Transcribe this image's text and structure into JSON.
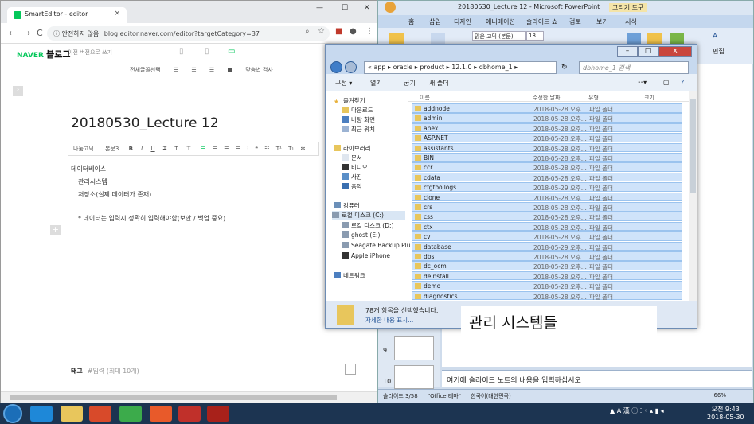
{
  "chrome": {
    "tab_title": "SmartEditor - editor",
    "close_icon": "×",
    "minimize": "—",
    "maximize": "☐",
    "close": "✕",
    "back": "←",
    "forward": "→",
    "reload": "C",
    "security": "ⓘ 안전하지 않음",
    "url": "blog.editor.naver.com/editor?targetCategory=37"
  },
  "editor": {
    "brand": "NAVER",
    "brand_sub": "블로그",
    "prev_version": "이전 버전으로 쓰기",
    "select_all": "전체글꼴선택",
    "spellcheck": "맞춤법 검사",
    "title": "20180530_Lecture 12",
    "font_name": "나눔고딕",
    "font_body": "본문3",
    "lines": [
      "데이터베이스",
      "관리시스템",
      "저장소(실제 데이터가 존재)",
      "* 데이터는 입력시 정확히 입력해야함(보안 / 백업 중요)"
    ],
    "tag_label": "태그",
    "tag_placeholder": "#입력 (최대 10개)"
  },
  "ppt": {
    "title": "20180530_Lecture 12 - Microsoft PowerPoint",
    "drawing_tools": "그리기 도구",
    "tabs": [
      "홈",
      "삽입",
      "디자인",
      "애니메이션",
      "슬라이드 쇼",
      "검토",
      "보기",
      "서식"
    ],
    "font": "맑은 고딕 (본문)",
    "size": "18",
    "edit_label": "편집",
    "slide_nums": [
      "9",
      "10"
    ],
    "notes": "여기에 슬라이드 노트의 내용을 입력하십시오",
    "status_slide": "슬라이드 3/58",
    "status_theme": "\"Office 테마\"",
    "status_lang": "한국어(대한민국)",
    "zoom": "66%"
  },
  "explorer": {
    "breadcrumb": "« app ▸ oracle ▸ product ▸ 12.1.0 ▸ dbhome_1 ▸",
    "search_placeholder": "dbhome_1 검색",
    "toolbar": [
      "구성 ▾",
      "열기",
      "굽기",
      "새 폴더"
    ],
    "nav_favorites": "즐겨찾기",
    "nav_items": [
      "다운로드",
      "바탕 화면",
      "최근 위치"
    ],
    "nav_library": "라이브러리",
    "library_items": [
      "문서",
      "비디오",
      "사진",
      "음악"
    ],
    "nav_computer": "컴퓨터",
    "drives": [
      "로컬 디스크 (C:)",
      "로컬 디스크 (D:)",
      "ghost (E:)",
      "Seagate Backup Plu",
      "Apple iPhone"
    ],
    "nav_network": "네트워크",
    "col_name": "이름",
    "col_date": "수정한 날짜",
    "col_type": "유형",
    "col_size": "크기",
    "folders": [
      "addnode",
      "admin",
      "apex",
      "ASP.NET",
      "assistants",
      "BIN",
      "ccr",
      "cdata",
      "cfgtoollogs",
      "clone",
      "crs",
      "css",
      "ctx",
      "cv",
      "database",
      "dbs",
      "dc_ocm",
      "deinstall",
      "demo",
      "diagnostics"
    ],
    "dates": [
      "2018-05-28 오후...",
      "2018-05-28 오후...",
      "2018-05-28 오후...",
      "2018-05-28 오후...",
      "2018-05-28 오후...",
      "2018-05-28 오후...",
      "2018-05-28 오후...",
      "2018-05-28 오후...",
      "2018-05-29 오후...",
      "2018-05-28 오후...",
      "2018-05-28 오후...",
      "2018-05-28 오후...",
      "2018-05-28 오후...",
      "2018-05-28 오후...",
      "2018-05-29 오후...",
      "2018-05-28 오후...",
      "2018-05-28 오후...",
      "2018-05-28 오후...",
      "2018-05-28 오후...",
      "2018-05-28 오후..."
    ],
    "folder_type": "파일 폴더",
    "status_selected": "78개 항목을 선택했습니다.",
    "status_more": "자세한 내용 표시..."
  },
  "annotation": "관리 시스템들",
  "taskbar": {
    "tray": "▲ A 漢 ⓘ ⁚ ◦ ▴ ▮ ◂",
    "time": "오전 9:43",
    "date": "2018-05-30"
  }
}
